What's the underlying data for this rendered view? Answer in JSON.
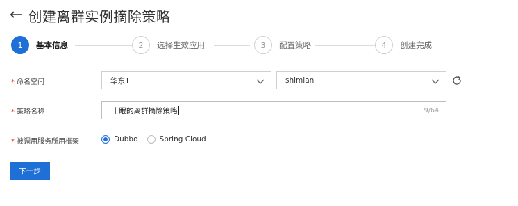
{
  "header": {
    "back_icon": "arrow-left-icon",
    "title": "创建离群实例摘除策略"
  },
  "steps": [
    {
      "number": "1",
      "label": "基本信息",
      "active": true
    },
    {
      "number": "2",
      "label": "选择生效应用",
      "active": false
    },
    {
      "number": "3",
      "label": "配置策略",
      "active": false
    },
    {
      "number": "4",
      "label": "创建完成",
      "active": false
    }
  ],
  "form": {
    "namespace": {
      "required_mark": "*",
      "label": "命名空间",
      "region_value": "华东1",
      "namespace_value": "shimian",
      "refresh_icon": "refresh-icon"
    },
    "policy_name": {
      "required_mark": "*",
      "label": "策略名称",
      "value": "十眠的离群摘除策略",
      "counter": "9/64"
    },
    "framework": {
      "required_mark": "*",
      "label": "被调用服务所用框架",
      "options": [
        {
          "label": "Dubbo",
          "checked": true
        },
        {
          "label": "Spring Cloud",
          "checked": false
        }
      ]
    }
  },
  "actions": {
    "next_label": "下一步"
  },
  "colors": {
    "accent": "#1e6fd6",
    "required": "#e33333"
  }
}
